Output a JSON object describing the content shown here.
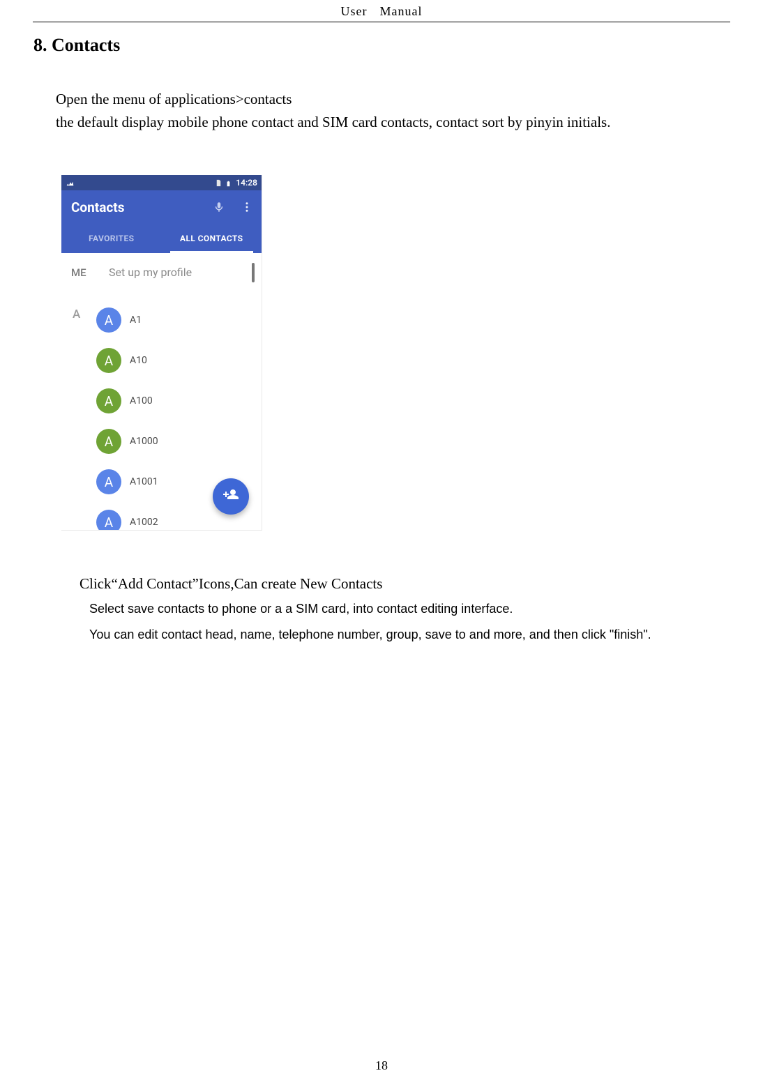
{
  "header": {
    "left": "User",
    "right": "Manual"
  },
  "section_title": "8. Contacts",
  "intro_line1": "Open the menu of applications>contacts",
  "intro_line2": "the default display mobile phone contact and SIM card contacts, contact sort by pinyin initials.",
  "phone": {
    "statusbar": {
      "time": "14:28"
    },
    "title": "Contacts",
    "tabs": {
      "favorites": "FAVORITES",
      "all": "ALL CONTACTS"
    },
    "me_label": "ME",
    "me_text": "Set up my profile",
    "section_letter": "A",
    "contacts": [
      {
        "initial": "A",
        "name": "A1",
        "color": "blue"
      },
      {
        "initial": "A",
        "name": "A10",
        "color": "green"
      },
      {
        "initial": "A",
        "name": "A100",
        "color": "green"
      },
      {
        "initial": "A",
        "name": "A1000",
        "color": "green"
      },
      {
        "initial": "A",
        "name": "A1001",
        "color": "blue"
      },
      {
        "initial": "A",
        "name": "A1002",
        "color": "blue"
      }
    ]
  },
  "below": {
    "line1": "Click“Add    Contact”Icons,Can create New Contacts",
    "line2": "Select save contacts to phone or a a SIM card, into contact editing interface.",
    "line3": "You can edit contact head, name, telephone number, group, save to and more, and then click \"finish\"."
  },
  "page_number": "18"
}
